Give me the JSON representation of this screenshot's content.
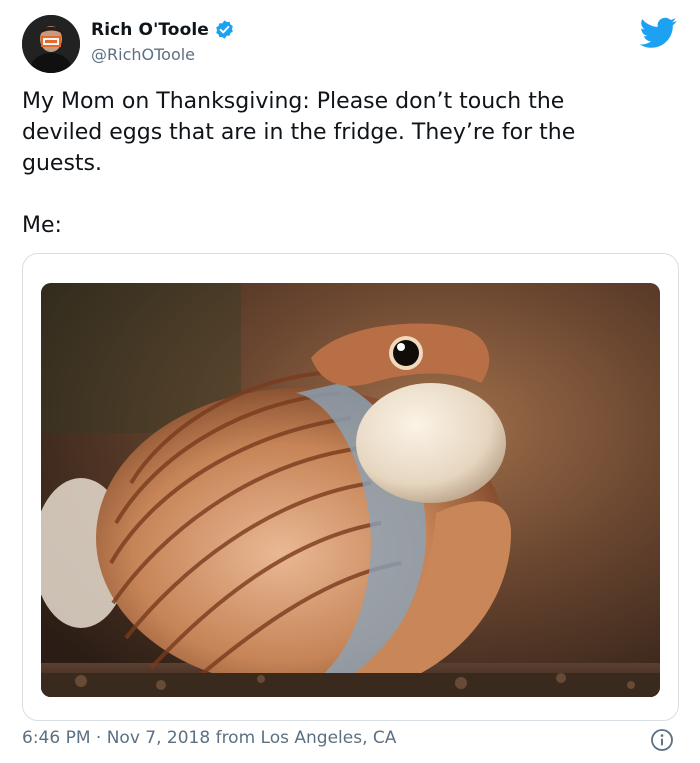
{
  "tweet": {
    "author_name": "Rich O'Toole",
    "handle": "@RichOToole",
    "line1": "My Mom on Thanksgiving: Please don’t touch the",
    "line2": "deviled eggs that are in the fridge. They’re for the",
    "line3": "guests.",
    "line4": "Me:",
    "meta": "6:46 PM · Nov 7, 2018 from Los Angeles, CA"
  },
  "icons": {
    "verified": "verified-badge-icon",
    "brand": "twitter-bird-icon",
    "info": "info-icon"
  },
  "colors": {
    "brand_blue": "#1da1f2",
    "secondary_text": "#5b7083",
    "primary_text": "#0f1419"
  }
}
